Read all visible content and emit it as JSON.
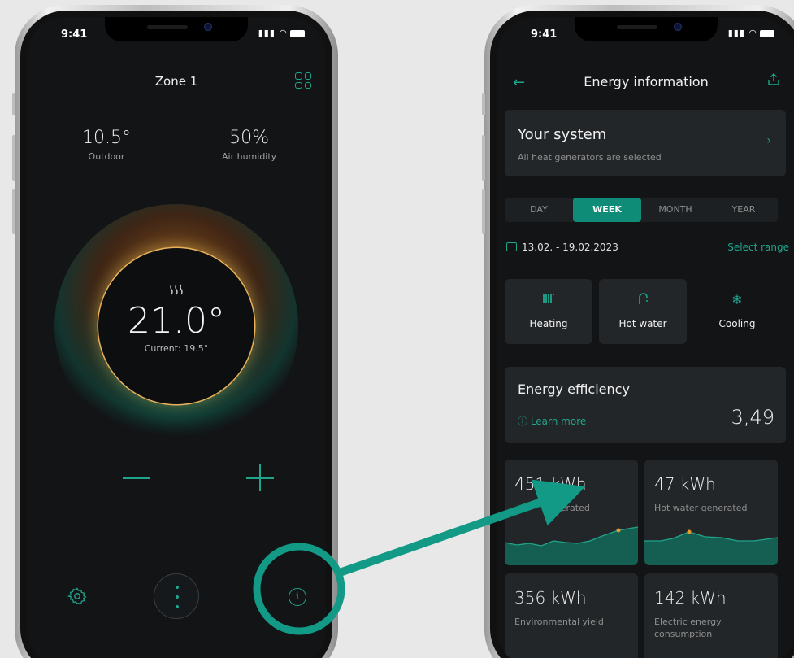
{
  "left_phone": {
    "status_time": "9:41",
    "zone_title": "Zone 1",
    "outdoor_value": "10.5°",
    "outdoor_label": "Outdoor",
    "humidity_value": "50%",
    "humidity_label": "Air humidity",
    "heat_symbol": "∨∨∨",
    "setpoint": "21.0°",
    "current_label": "Current: 19.5°"
  },
  "right_phone": {
    "status_time": "9:41",
    "title": "Energy information",
    "system_title": "Your system",
    "system_subtitle": "All heat generators are selected",
    "periods": [
      "DAY",
      "WEEK",
      "MONTH",
      "YEAR"
    ],
    "selected_period": "WEEK",
    "date_range": "13.02. - 19.02.2023",
    "select_range": "Select range",
    "categories": [
      "Heating",
      "Hot water",
      "Cooling"
    ],
    "efficiency_title": "Energy efficiency",
    "learn_more": "Learn more",
    "efficiency_value": "3,49",
    "tiles": [
      {
        "value": "451 kWh",
        "label": "generated"
      },
      {
        "value": "47 kWh",
        "label": "Hot water generated"
      },
      {
        "value": "356 kWh",
        "label": "Environmental yield"
      },
      {
        "value": "142 kWh",
        "label": "Electric energy consumption"
      }
    ]
  },
  "colors": {
    "accent": "#1fa58c",
    "background": "#121416",
    "card": "#232628",
    "highlight": "#e59a2e"
  }
}
